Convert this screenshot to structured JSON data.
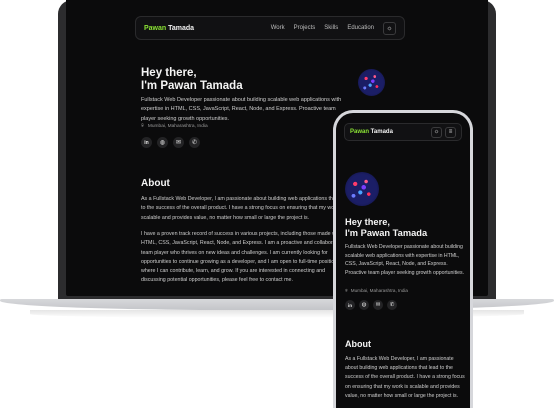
{
  "brand": {
    "first": "Pawan",
    "last": " Tamada"
  },
  "nav": {
    "links": [
      "Work",
      "Projects",
      "Skills",
      "Education"
    ],
    "theme_icon": "sun-icon",
    "menu_icon": "menu-icon"
  },
  "hero": {
    "greeting": "Hey there,",
    "name_line": "I'm Pawan Tamada",
    "description": "Fullstack Web Developer passionate about building scalable web applications with expertise in HTML, CSS, JavaScript, React, Node, and Express. Proactive team player seeking growth opportunities.",
    "location": "Mumbai, Maharashtra, India",
    "socials": [
      {
        "name": "linkedin-icon",
        "glyph": "in"
      },
      {
        "name": "globe-icon",
        "glyph": "◍"
      },
      {
        "name": "mail-icon",
        "glyph": "✉"
      },
      {
        "name": "phone-icon",
        "glyph": "✆"
      }
    ]
  },
  "about": {
    "title": "About",
    "p1": "As a Fullstack Web Developer, I am passionate about building web applications that lead to the success of the overall product. I have a strong focus on ensuring that my work is scalable and provides value, no matter how small or large the project is.",
    "p2": "I have a proven track record of success in various projects, including those made with HTML, CSS, JavaScript, React, Node, and Express. I am a proactive and collaborative team player who thrives on new ideas and challenges. I am currently looking for opportunities to continue growing as a developer, and I am open to full-time positions where I can contribute, learn, and grow. If you are interested in connecting and discussing potential opportunities, please feel free to contact me."
  },
  "phone_about": {
    "p": "As a Fullstack Web Developer, I am passionate about building web applications that lead to the success of the overall product. I have a strong focus on ensuring that my work is scalable and provides value, no matter how small or large the project is."
  }
}
